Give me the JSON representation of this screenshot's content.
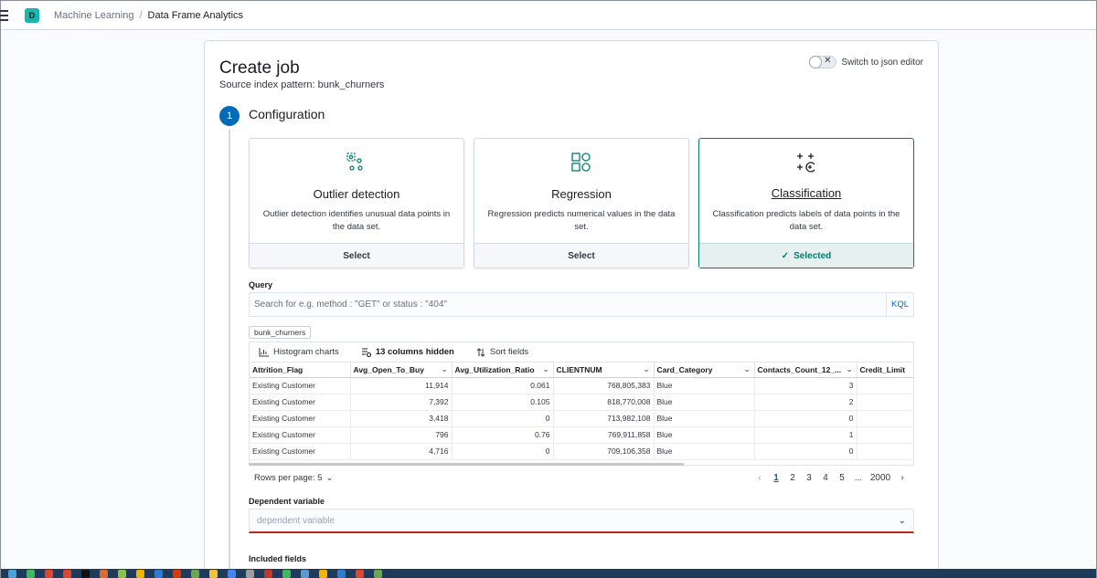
{
  "header": {
    "space_initial": "D",
    "breadcrumbs": [
      "Machine Learning",
      "Data Frame Analytics"
    ]
  },
  "page": {
    "title": "Create job",
    "subtitle": "Source index pattern: bunk_churners",
    "json_switch_label": "Switch to json editor",
    "json_editor_enabled": false
  },
  "step": {
    "number": "1",
    "title": "Configuration"
  },
  "job_types": [
    {
      "title": "Outlier detection",
      "description": "Outlier detection identifies unusual data points in the data set.",
      "footer": "Select",
      "selected": false,
      "icon": "outlier-detection-icon"
    },
    {
      "title": "Regression",
      "description": "Regression predicts numerical values in the data set.",
      "footer": "Select",
      "selected": false,
      "icon": "regression-icon"
    },
    {
      "title": "Classification",
      "description": "Classification predicts labels of data points in the data set.",
      "footer": "Selected",
      "selected": true,
      "icon": "classification-icon"
    }
  ],
  "query": {
    "label": "Query",
    "placeholder": "Search for e.g. method : \"GET\" or status : \"404\"",
    "value": "",
    "language": "KQL"
  },
  "index_badge": "bunk_churners",
  "grid_toolbar": {
    "histogram": "Histogram charts",
    "columns_hidden": "13 columns hidden",
    "sort": "Sort fields"
  },
  "grid": {
    "columns": [
      "Attrition_Flag",
      "Avg_Open_To_Buy",
      "Avg_Utilization_Ratio",
      "CLIENTNUM",
      "Card_Category",
      "Contacts_Count_12_...",
      "Credit_Limit"
    ],
    "rows": [
      [
        "Existing Customer",
        "11,914",
        "0.061",
        "768,805,383",
        "Blue",
        "3",
        ""
      ],
      [
        "Existing Customer",
        "7,392",
        "0.105",
        "818,770,008",
        "Blue",
        "2",
        ""
      ],
      [
        "Existing Customer",
        "3,418",
        "0",
        "713,982,108",
        "Blue",
        "0",
        ""
      ],
      [
        "Existing Customer",
        "796",
        "0.76",
        "769,911,858",
        "Blue",
        "1",
        ""
      ],
      [
        "Existing Customer",
        "4,716",
        "0",
        "709,106,358",
        "Blue",
        "0",
        ""
      ]
    ]
  },
  "pagination": {
    "rows_per_page": "Rows per page: 5",
    "pages": [
      "1",
      "2",
      "3",
      "4",
      "5"
    ],
    "ellipsis": "...",
    "last_page": "2000",
    "current": "1"
  },
  "dependent_variable": {
    "label": "Dependent variable",
    "placeholder": "dependent variable"
  },
  "included_fields": {
    "label": "Included fields"
  },
  "colors": {
    "accent": "#006bb8",
    "success": "#017d73",
    "danger": "#bd271e"
  }
}
